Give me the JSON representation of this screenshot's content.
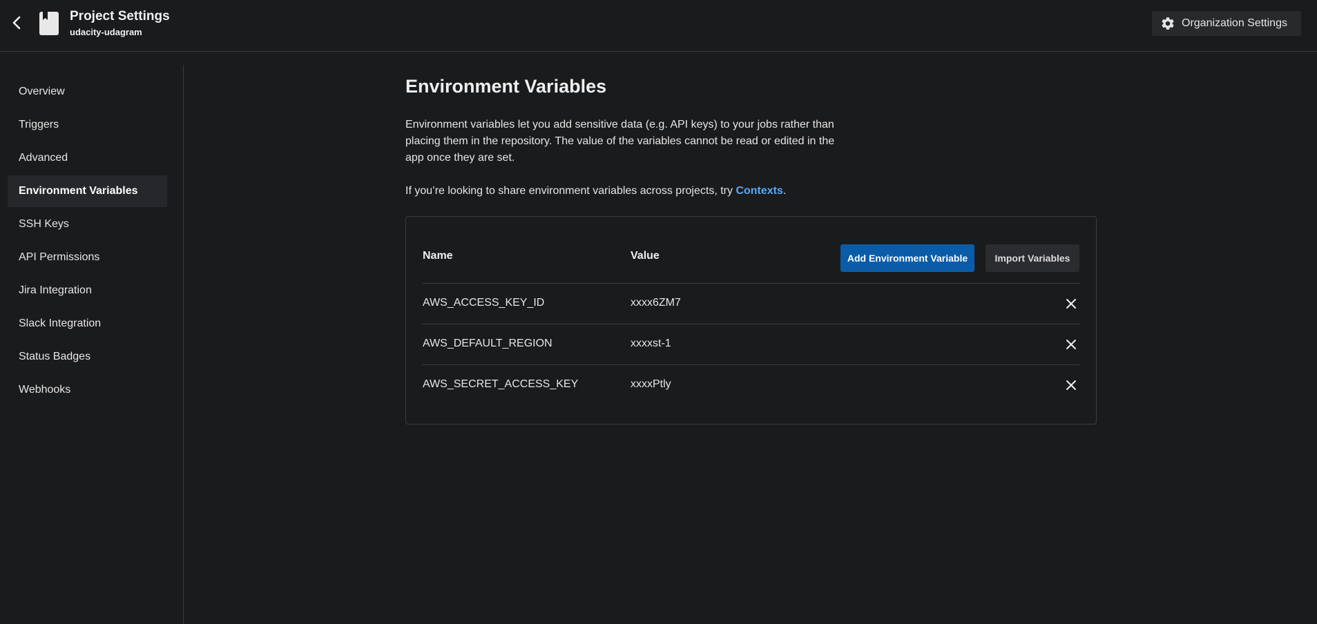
{
  "header": {
    "title": "Project Settings",
    "project_name": "udacity-udagram",
    "org_settings_label": "Organization Settings"
  },
  "sidebar": {
    "items": [
      {
        "label": "Overview"
      },
      {
        "label": "Triggers"
      },
      {
        "label": "Advanced"
      },
      {
        "label": "Environment Variables",
        "active": true
      },
      {
        "label": "SSH Keys"
      },
      {
        "label": "API Permissions"
      },
      {
        "label": "Jira Integration"
      },
      {
        "label": "Slack Integration"
      },
      {
        "label": "Status Badges"
      },
      {
        "label": "Webhooks"
      }
    ]
  },
  "main": {
    "title": "Environment Variables",
    "description": "Environment variables let you add sensitive data (e.g. API keys) to your jobs rather than placing them in the repository. The value of the variables cannot be read or edited in the app once they are set.",
    "share_prefix": "If you’re looking to share environment variables across projects, try ",
    "share_link": "Contexts",
    "share_suffix": "."
  },
  "table": {
    "headers": {
      "name": "Name",
      "value": "Value"
    },
    "add_button_label": "Add Environment Variable",
    "import_button_label": "Import Variables",
    "rows": [
      {
        "name": "AWS_ACCESS_KEY_ID",
        "value": "xxxx6ZM7"
      },
      {
        "name": "AWS_DEFAULT_REGION",
        "value": "xxxxst-1"
      },
      {
        "name": "AWS_SECRET_ACCESS_KEY",
        "value": "xxxxPtly"
      }
    ]
  },
  "colors": {
    "background": "#1a1b1d",
    "primary_button": "#0b5ca8",
    "link": "#5aa9f5"
  },
  "icons": {
    "back": "chevron-left-icon",
    "project": "bookmark-icon",
    "org_settings": "gear-icon",
    "delete": "close-icon"
  }
}
